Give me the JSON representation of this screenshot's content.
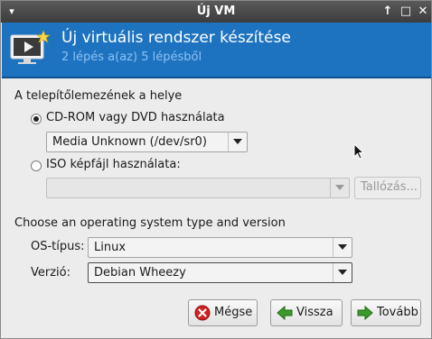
{
  "window": {
    "title": "Új VM",
    "controls": {
      "up": "↑",
      "maximize": "□",
      "close": "✕"
    }
  },
  "banner": {
    "heading": "Új virtuális rendszer készítése",
    "step": "2 lépés a(az) 5 lépésből",
    "icon": "monitor-star-icon"
  },
  "install_media": {
    "section_label": "A telepítőlemezének a helye",
    "cdrom": {
      "label": "CD-ROM vagy DVD használata",
      "selected": true
    },
    "cdrom_device": "Media Unknown (/dev/sr0)",
    "iso": {
      "label": "ISO képfájl használata:",
      "selected": false
    },
    "iso_path": "",
    "browse_label": "Tallózás..."
  },
  "os": {
    "section_label": "Choose an operating system type and version",
    "type_label": "OS-típus:",
    "type_value": "Linux",
    "version_label": "Verzió:",
    "version_value": "Debian Wheezy"
  },
  "buttons": {
    "cancel": "Mégse",
    "back": "Vissza",
    "forward": "Tovább"
  },
  "colors": {
    "banner": "#1e73c0",
    "banner_subtitle": "#8dc1f2",
    "cancel_icon": "#d32020",
    "nav_icon": "#3a9a2a"
  }
}
